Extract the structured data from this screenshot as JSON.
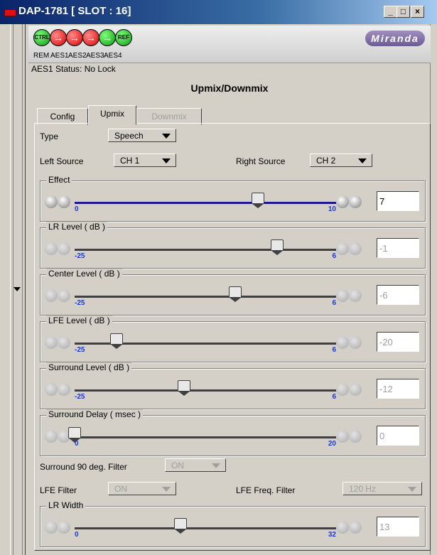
{
  "window": {
    "title": "DAP-1781 [ SLOT : 16]"
  },
  "header": {
    "leds": [
      {
        "icon": "ctrl-led-icon",
        "text": "CTRL",
        "color": "#19b019"
      },
      {
        "icon": "aes1-led-icon",
        "text": "→",
        "color": "#e01010"
      },
      {
        "icon": "aes2-led-icon",
        "text": "→",
        "color": "#e01010"
      },
      {
        "icon": "aes3-led-icon",
        "text": "→",
        "color": "#e01010"
      },
      {
        "icon": "aes4-led-icon",
        "text": "→",
        "color": "#19b019"
      },
      {
        "icon": "ref-led-icon",
        "text": "REF",
        "color": "#19b019"
      }
    ],
    "led_labels": [
      "REM",
      "AES1",
      "AES2",
      "AES3",
      "AES4"
    ],
    "logo": "Miranda"
  },
  "status": "AES1 Status: No Lock",
  "section_title": "Upmix/Downmix",
  "tabs": [
    "Config",
    "Upmix",
    "Downmix"
  ],
  "form": {
    "type_label": "Type",
    "type_value": "Speech",
    "left_source_label": "Left Source",
    "left_source_value": "CH 1",
    "right_source_label": "Right Source",
    "right_source_value": "CH 2",
    "surround_filter_label": "Surround 90 deg. Filter",
    "surround_filter_value": "ON",
    "lfe_filter_label": "LFE Filter",
    "lfe_filter_value": "ON",
    "lfe_freq_label": "LFE Freq. Filter",
    "lfe_freq_value": "120 Hz"
  },
  "sliders": [
    {
      "title": "Effect",
      "min": "0",
      "max": "10",
      "value": "7",
      "enabled": true,
      "fraction": 0.7
    },
    {
      "title": "LR Level ( dB )",
      "min": "-25",
      "max": "6",
      "value": "-1",
      "enabled": false,
      "fraction": 0.774
    },
    {
      "title": "Center Level ( dB )",
      "min": "-25",
      "max": "6",
      "value": "-6",
      "enabled": false,
      "fraction": 0.613
    },
    {
      "title": "LFE Level ( dB )",
      "min": "-25",
      "max": "6",
      "value": "-20",
      "enabled": false,
      "fraction": 0.161
    },
    {
      "title": "Surround Level ( dB )",
      "min": "-25",
      "max": "6",
      "value": "-12",
      "enabled": false,
      "fraction": 0.419
    },
    {
      "title": "Surround Delay ( msec )",
      "min": "0",
      "max": "20",
      "value": "0",
      "enabled": false,
      "fraction": 0.0
    },
    {
      "title": "LR Width",
      "min": "0",
      "max": "32",
      "value": "13",
      "enabled": false,
      "fraction": 0.406
    }
  ]
}
